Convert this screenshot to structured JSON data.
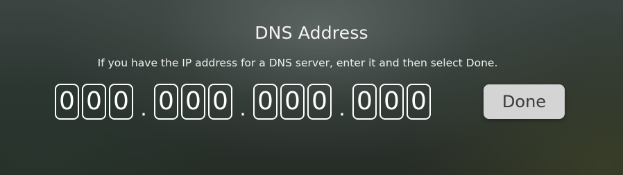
{
  "dialog": {
    "title": "DNS Address",
    "instructions": "If you have the IP address for a DNS server, enter it and then select Done.",
    "octets": [
      [
        "0",
        "0",
        "0"
      ],
      [
        "0",
        "0",
        "0"
      ],
      [
        "0",
        "0",
        "0"
      ],
      [
        "0",
        "0",
        "0"
      ]
    ],
    "separator": ".",
    "done_label": "Done"
  }
}
